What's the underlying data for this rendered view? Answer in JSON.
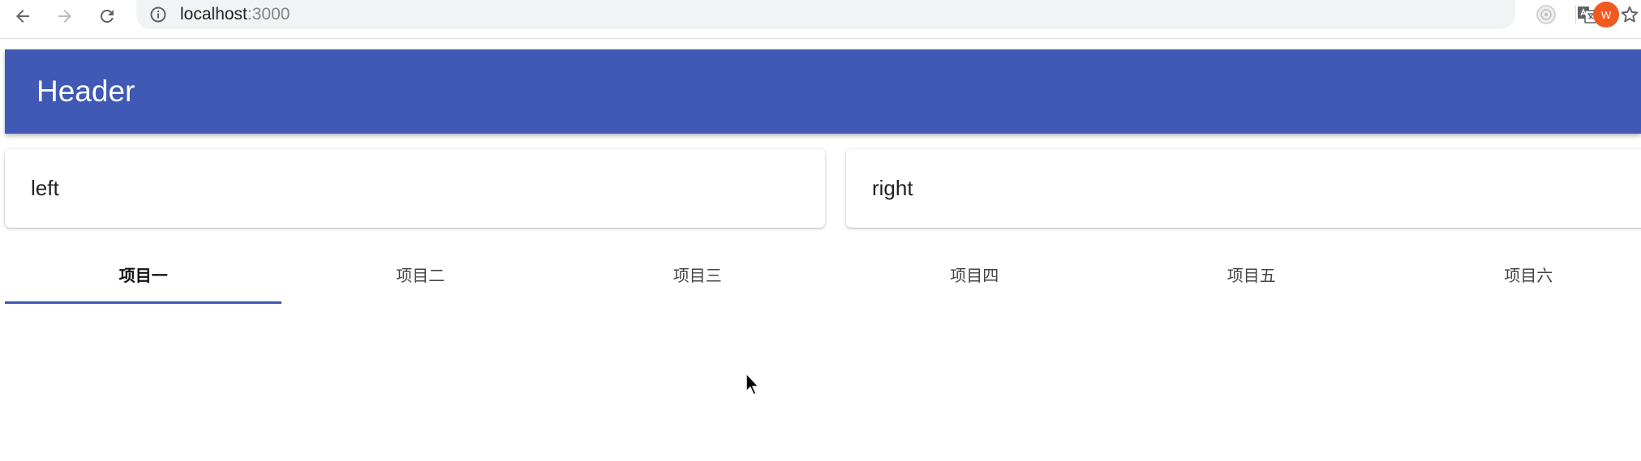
{
  "browser": {
    "url_host": "localhost",
    "url_port": ":3000",
    "avatar_letter": "W"
  },
  "header": {
    "title": "Header"
  },
  "papers": {
    "left": "left",
    "right": "right"
  },
  "tabs": [
    {
      "label": "项目一",
      "active": true
    },
    {
      "label": "项目二",
      "active": false
    },
    {
      "label": "项目三",
      "active": false
    },
    {
      "label": "项目四",
      "active": false
    },
    {
      "label": "项目五",
      "active": false
    },
    {
      "label": "项目六",
      "active": false
    }
  ],
  "colors": {
    "primary": "#3f59b4",
    "avatar": "#f05a22"
  }
}
